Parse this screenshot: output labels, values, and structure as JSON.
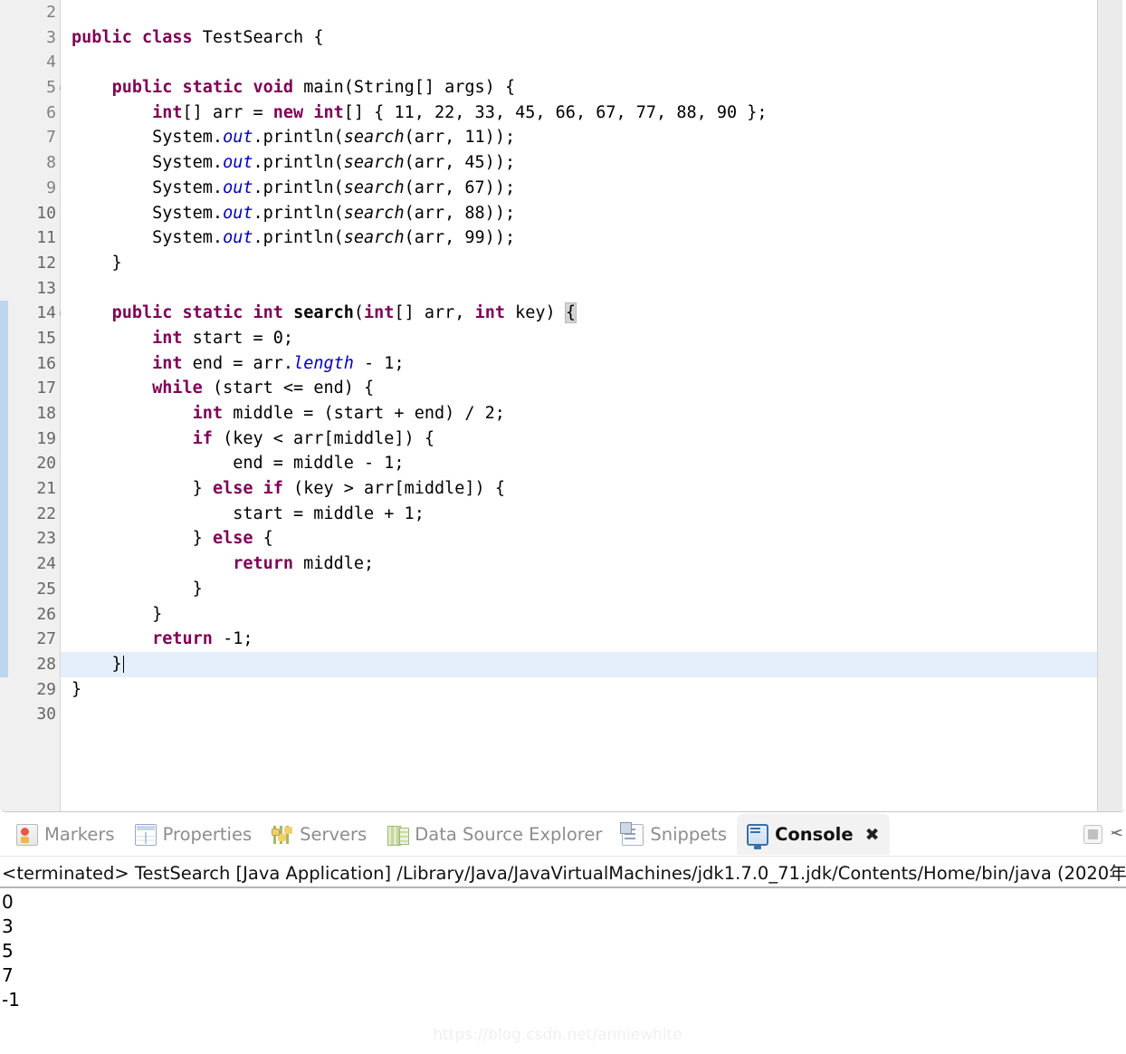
{
  "editor": {
    "first_line_number": 2,
    "last_line_number": 30,
    "current_line": 28,
    "change_bar_from": 14,
    "change_bar_to": 28,
    "fold_lines": [
      5,
      14
    ],
    "lines": [
      {
        "n": 2,
        "text": ""
      },
      {
        "n": 3,
        "text": "public class TestSearch {"
      },
      {
        "n": 4,
        "text": ""
      },
      {
        "n": 5,
        "text": "    public static void main(String[] args) {"
      },
      {
        "n": 6,
        "text": "        int[] arr = new int[] { 11, 22, 33, 45, 66, 67, 77, 88, 90 };"
      },
      {
        "n": 7,
        "text": "        System.out.println(search(arr, 11));"
      },
      {
        "n": 8,
        "text": "        System.out.println(search(arr, 45));"
      },
      {
        "n": 9,
        "text": "        System.out.println(search(arr, 67));"
      },
      {
        "n": 10,
        "text": "        System.out.println(search(arr, 88));"
      },
      {
        "n": 11,
        "text": "        System.out.println(search(arr, 99));"
      },
      {
        "n": 12,
        "text": "    }"
      },
      {
        "n": 13,
        "text": ""
      },
      {
        "n": 14,
        "text": "    public static int search(int[] arr, int key) {"
      },
      {
        "n": 15,
        "text": "        int start = 0;"
      },
      {
        "n": 16,
        "text": "        int end = arr.length - 1;"
      },
      {
        "n": 17,
        "text": "        while (start <= end) {"
      },
      {
        "n": 18,
        "text": "            int middle = (start + end) / 2;"
      },
      {
        "n": 19,
        "text": "            if (key < arr[middle]) {"
      },
      {
        "n": 20,
        "text": "                end = middle - 1;"
      },
      {
        "n": 21,
        "text": "            } else if (key > arr[middle]) {"
      },
      {
        "n": 22,
        "text": "                start = middle + 1;"
      },
      {
        "n": 23,
        "text": "            } else {"
      },
      {
        "n": 24,
        "text": "                return middle;"
      },
      {
        "n": 25,
        "text": "            }"
      },
      {
        "n": 26,
        "text": "        }"
      },
      {
        "n": 27,
        "text": "        return -1;"
      },
      {
        "n": 28,
        "text": "    }"
      },
      {
        "n": 29,
        "text": "}"
      },
      {
        "n": 30,
        "text": ""
      }
    ],
    "colors": {
      "keyword": "#7f0055",
      "field": "#0000c0",
      "plain": "#000000",
      "line_number": "#808080",
      "gutter_bg": "#f0f0f0",
      "change_bar": "#bcd6f0",
      "current_line_bg": "#e4effb",
      "bracket_highlight": "#d4d4d4"
    }
  },
  "bottom_panel": {
    "tabs": [
      {
        "label": "Markers",
        "icon": "markers-icon",
        "active": false
      },
      {
        "label": "Properties",
        "icon": "properties-icon",
        "active": false
      },
      {
        "label": "Servers",
        "icon": "servers-icon",
        "active": false
      },
      {
        "label": "Data Source Explorer",
        "icon": "data-source-explorer-icon",
        "active": false
      },
      {
        "label": "Snippets",
        "icon": "snippets-icon",
        "active": false
      },
      {
        "label": "Console",
        "icon": "console-icon",
        "active": true,
        "close_glyph": "✖"
      }
    ],
    "toolbar": {
      "stop_label": "stop-button",
      "scissors_label": "cut-button"
    },
    "console": {
      "terminated_line": "<terminated> TestSearch [Java Application] /Library/Java/JavaVirtualMachines/jdk1.7.0_71.jdk/Contents/Home/bin/java (2020年",
      "output": [
        "0",
        "3",
        "5",
        "7",
        "-1"
      ]
    }
  },
  "watermark": {
    "text": "https://blog.csdn.net/anniewhite"
  }
}
